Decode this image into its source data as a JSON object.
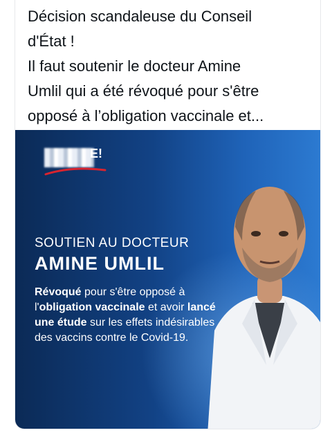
{
  "tweet": {
    "text": "Décision scandaleuse du Conseil\nd'État !\nIl faut soutenir le docteur Amine\nUmlil qui a été révoqué pour s'être\nopposé à l’obligation vaccinale et..."
  },
  "media": {
    "logo_suffix": "E!",
    "headline_line1": "SOUTIEN AU DOCTEUR",
    "headline_line2": "AMINE UMLIL",
    "body": {
      "part1_bold": "Révoqué",
      "part2": " pour s'être opposé à l'",
      "part3_bold": "obligation vaccinale",
      "part4": " et avoir ",
      "part5_bold": "lancé une étude",
      "part6": " sur les effets indésirables des vaccins contre le Covid-19."
    },
    "colors": {
      "background_dark": "#0b2a56",
      "background_light": "#2c7ad1",
      "swoosh": "#d8242f"
    }
  }
}
